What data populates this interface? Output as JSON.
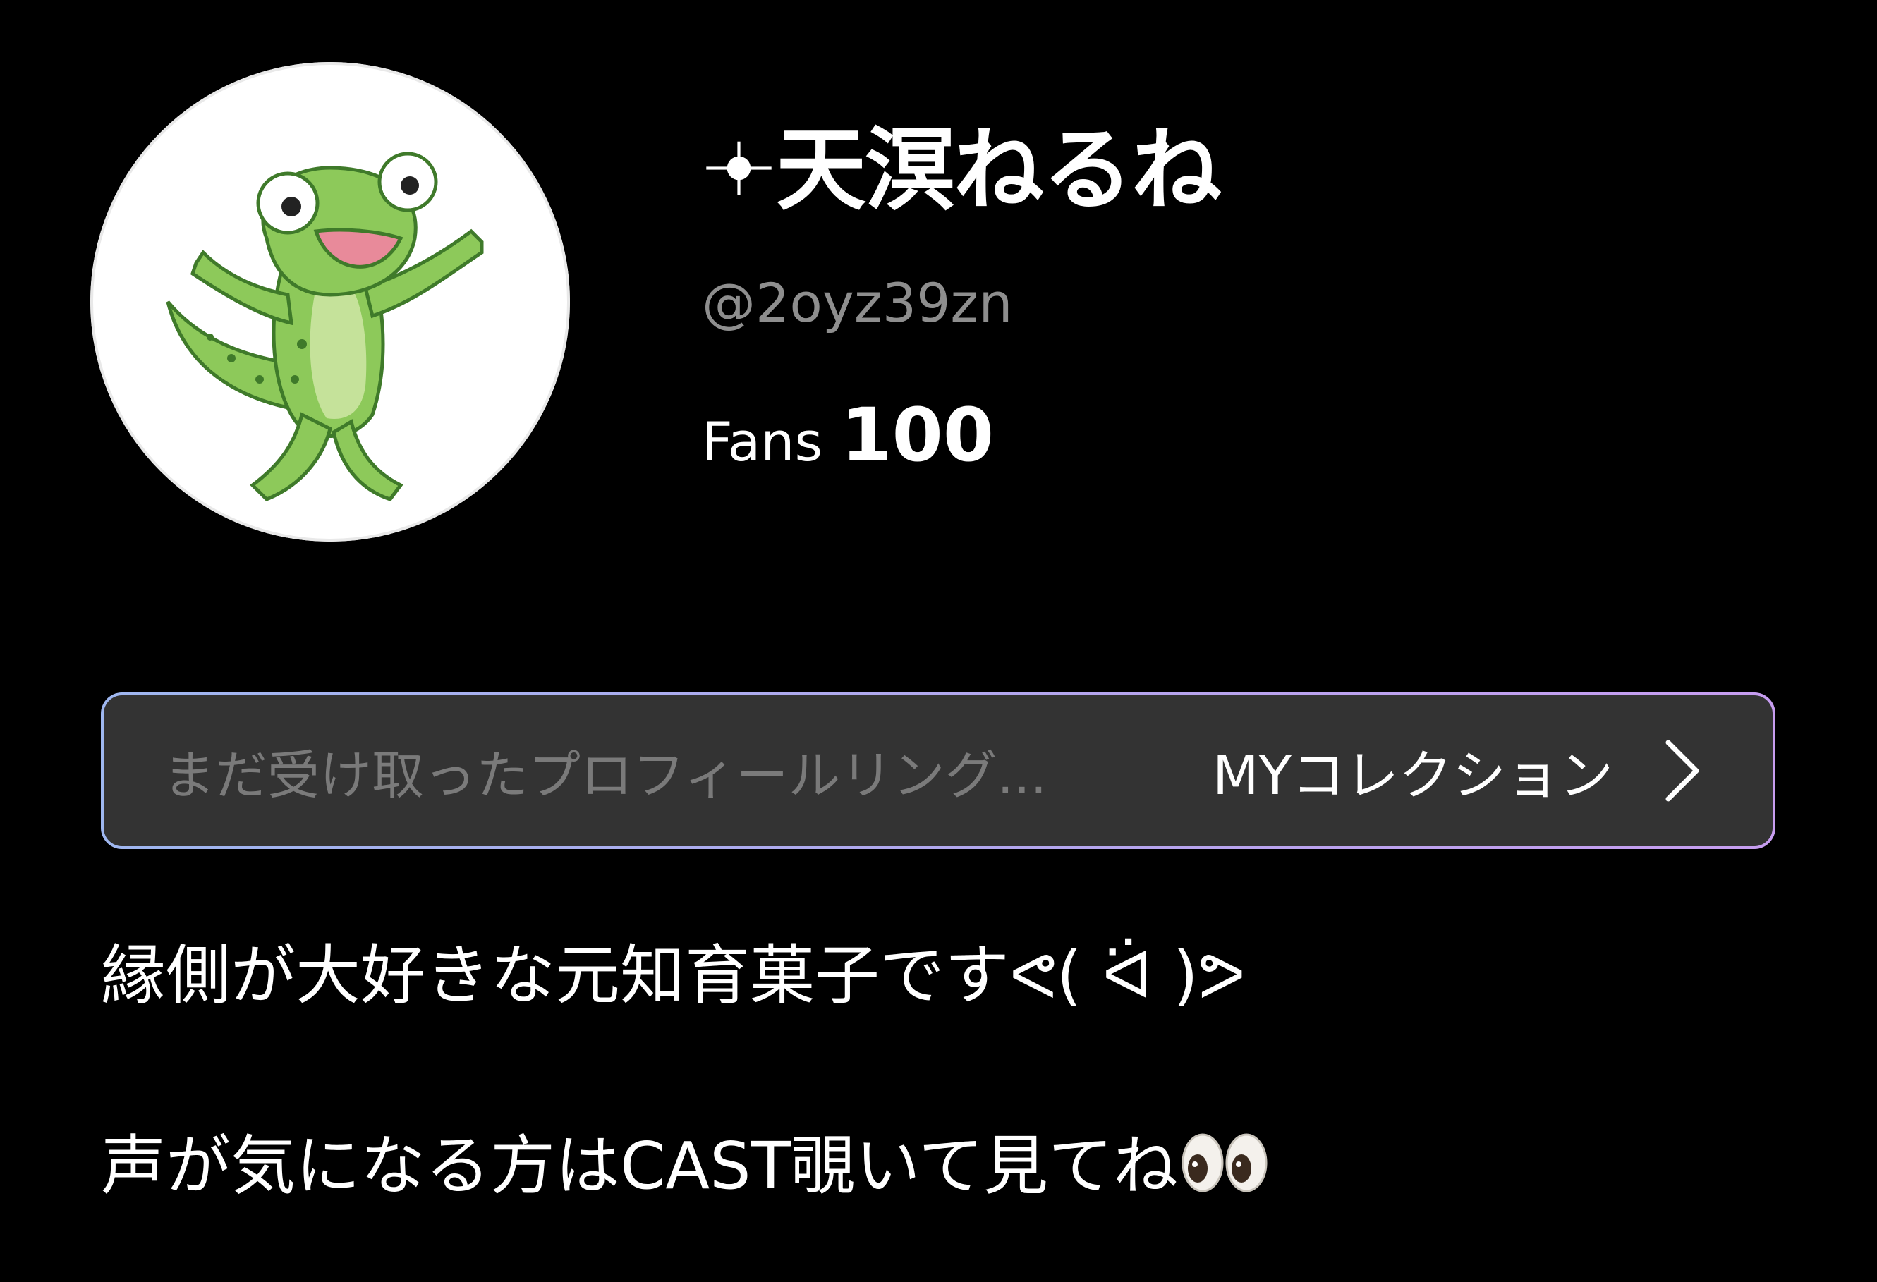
{
  "profile": {
    "display_name": "天溟ねるね",
    "name_prefix_icon": "sparkle-icon",
    "handle": "@2oyz39zn",
    "fans_label": "Fans",
    "fans_count": "100",
    "avatar_icon": "gecko-avatar"
  },
  "collection_bar": {
    "hint": "まだ受け取ったプロフィールリング...",
    "link_label": "MYコレクション",
    "chevron_icon": "chevron-right-icon",
    "border_colors": [
      "#9fb7f0",
      "#c79df0"
    ],
    "background": "#333333"
  },
  "bio": {
    "line1": "縁側が大好きな元知育菓子ですᕙ( ᐛ )ᕗ",
    "line2_text": "声が気になる方はCAST覗いて見てね",
    "line2_emoji": "eyes-icon"
  }
}
